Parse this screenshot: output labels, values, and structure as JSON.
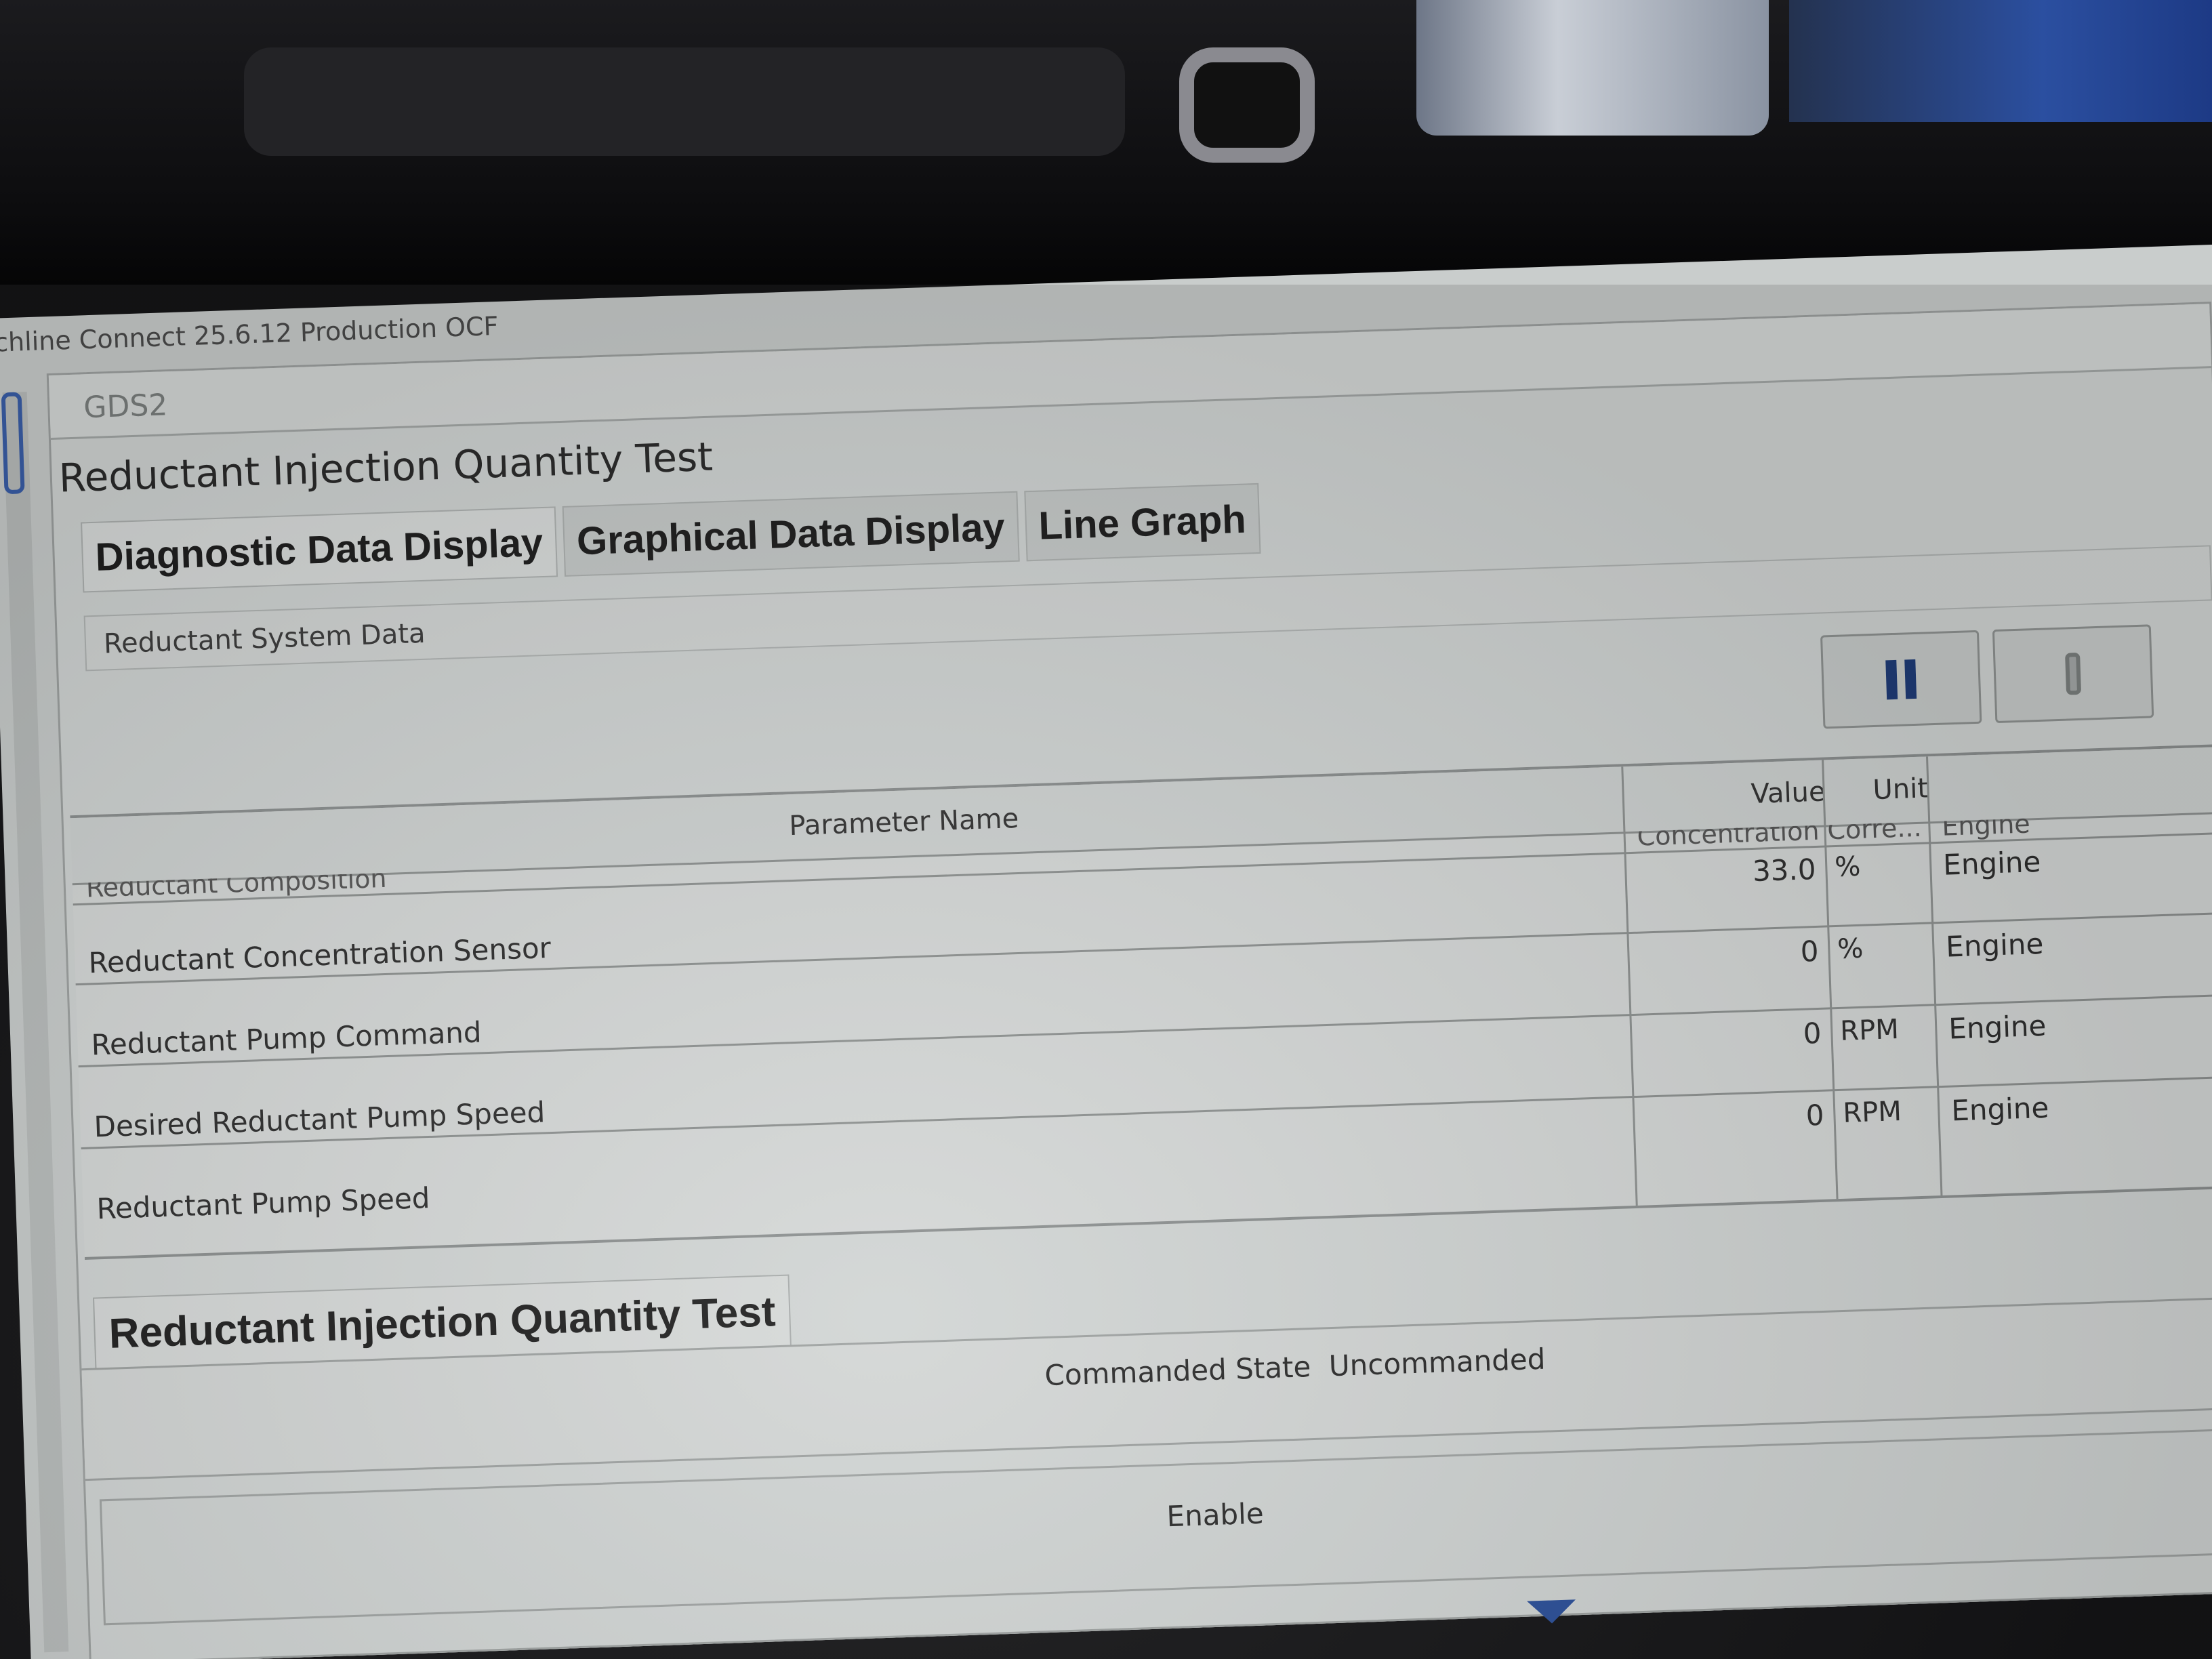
{
  "window": {
    "title": "chline Connect 25.6.12 Production OCF"
  },
  "app": {
    "name": "GDS2"
  },
  "page": {
    "title": "Reductant Injection Quantity Test"
  },
  "tabs": [
    {
      "label": "Diagnostic Data Display",
      "active": true
    },
    {
      "label": "Graphical Data Display",
      "active": false
    },
    {
      "label": "Line Graph",
      "active": false
    }
  ],
  "section": {
    "title": "Reductant System Data"
  },
  "toolbar": {
    "buttons": [
      {
        "icon": "pause-icon"
      },
      {
        "icon": "grip-icon"
      }
    ]
  },
  "table": {
    "columns": {
      "name": "Parameter Name",
      "value": "Value",
      "unit": "Unit"
    },
    "partial_row": {
      "name": "Reductant Composition",
      "value": "Concentration Corre...",
      "system": "Engine"
    },
    "rows": [
      {
        "name": "Reductant Concentration Sensor",
        "value": "33.0",
        "unit": "%",
        "system": "Engine"
      },
      {
        "name": "Reductant Pump Command",
        "value": "0",
        "unit": "%",
        "system": "Engine"
      },
      {
        "name": "Desired Reductant Pump Speed",
        "value": "0",
        "unit": "RPM",
        "system": "Engine"
      },
      {
        "name": "Reductant Pump Speed",
        "value": "0",
        "unit": "RPM",
        "system": "Engine"
      }
    ]
  },
  "test_panel": {
    "title": "Reductant Injection Quantity Test",
    "commanded_state_label": "Commanded State",
    "commanded_state_value": "Uncommanded",
    "control": {
      "label": "Enable"
    }
  },
  "colors": {
    "accent": "#2a4f9a",
    "screen_bg": "#c9cdcc"
  }
}
